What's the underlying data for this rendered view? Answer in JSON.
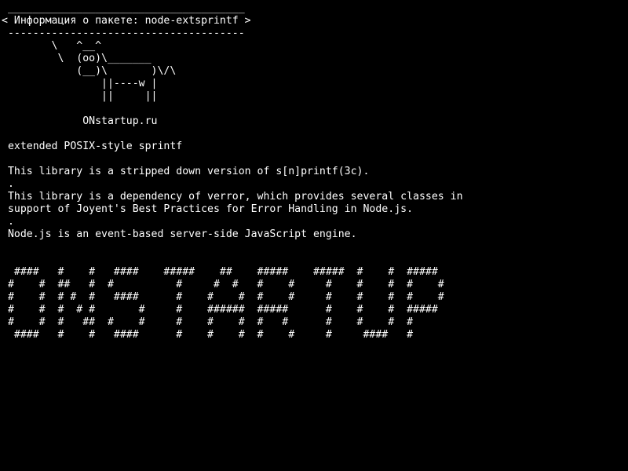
{
  "terminal": {
    "lines": [
      " ______________________________________",
      "< Информация о пакете: node-extsprintf >",
      " --------------------------------------",
      "        \\   ^__^",
      "         \\  (oo)\\_______",
      "            (__)\\       )\\/\\",
      "                ||----w |",
      "                ||     ||",
      "",
      "             ONstartup.ru",
      "",
      " extended POSIX-style sprintf",
      "",
      " This library is a stripped down version of s[n]printf(3c).",
      " .",
      " This library is a dependency of verror, which provides several classes in",
      " support of Joyent's Best Practices for Error Handling in Node.js.",
      " .",
      " Node.js is an event-based server-side JavaScript engine.",
      "",
      "",
      "  ####   #    #   ####    #####    ##    #####    #####  #    #  #####",
      " #    #  ##   #  #          #     #  #   #    #     #    #    #  #    #",
      " #    #  # #  #   ####      #    #    #  #    #     #    #    #  #    #",
      " #    #  #  # #       #     #    ######  #####      #    #    #  #####",
      " #    #  #   ##  #    #     #    #    #  #   #      #    #    #  #",
      "  ####   #    #   ####      #    #    #  #    #     #     ####   #"
    ]
  }
}
